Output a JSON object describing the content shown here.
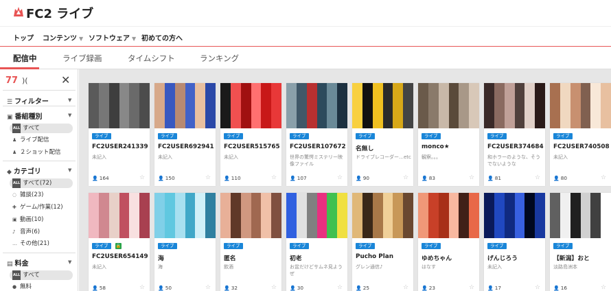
{
  "header": {
    "logo_text": "FC2 ライブ"
  },
  "nav": [
    {
      "label": "トップ",
      "caret": false
    },
    {
      "label": "コンテンツ",
      "caret": true
    },
    {
      "label": "ソフトウェア",
      "caret": true
    },
    {
      "label": "初めての方へ",
      "caret": false
    }
  ],
  "tabs": [
    "配信中",
    "ライブ録画",
    "タイムシフト",
    "ランキング"
  ],
  "active_tab": "配信中",
  "colors": {
    "accent": "#e85454",
    "live_badge": "#1a86d8",
    "lock_badge": "#29a34a",
    "grid_bg": "#e6e6e6"
  },
  "sidebar": {
    "count": "77",
    "filter_label": "フィルター",
    "program_type_label": "番組種別",
    "program_types": [
      "すべて",
      "ライブ配信",
      "２ショット配信"
    ],
    "category_label": "カテゴリ",
    "categories": [
      "すべて(72)",
      "雑談(23)",
      "ゲーム/作業(12)",
      "動画(10)",
      "音声(6)",
      "その他(21)"
    ],
    "fee_label": "料金",
    "fees": [
      "すべて",
      "無料"
    ],
    "all_box": "ALL"
  },
  "live_badge": "ライブ",
  "cards_row1": [
    {
      "name": "FC2USER241339",
      "desc": "未記入",
      "viewers": "164"
    },
    {
      "name": "FC2USER692941",
      "desc": "未記入",
      "viewers": "150"
    },
    {
      "name": "FC2USER515765",
      "desc": "未記入",
      "viewers": "110"
    },
    {
      "name": "FC2USER107672",
      "desc": "世界の驚愕ミステリー映像ファイル",
      "viewers": "107"
    },
    {
      "name": "名無し",
      "desc": "ドライブレコーダー…etc",
      "viewers": "90"
    },
    {
      "name": "monco★",
      "desc": "観察。。。",
      "viewers": "83"
    },
    {
      "name": "FC2USER374684",
      "desc": "和ホラーのような、そうでないような",
      "viewers": "81"
    },
    {
      "name": "FC2USER740508",
      "desc": "未記入",
      "viewers": "80"
    }
  ],
  "cards_row2": [
    {
      "name": "FC2USER654149",
      "desc": "未記入",
      "viewers": "58",
      "lock": true
    },
    {
      "name": "海",
      "desc": "海",
      "viewers": "50"
    },
    {
      "name": "匿名",
      "desc": "飲酒",
      "viewers": "32"
    },
    {
      "name": "初老",
      "desc": "お盆だけどサムネ見ようぜ",
      "viewers": "30"
    },
    {
      "name": "Pucho Plan",
      "desc": "グレン通信♪",
      "viewers": "25"
    },
    {
      "name": "ゆめちゃん",
      "desc": "はなす",
      "viewers": "23"
    },
    {
      "name": "げんじろう",
      "desc": "未記入",
      "viewers": "17"
    },
    {
      "name": "【新潟】おと",
      "desc": "淡路島洲本",
      "viewers": "16"
    }
  ],
  "icons": {
    "logo": "fc2-logo-icon",
    "close": "close-icon",
    "filter": "filter-icon",
    "viewer": "person-icon",
    "star": "star-icon",
    "lock": "lock-icon"
  }
}
